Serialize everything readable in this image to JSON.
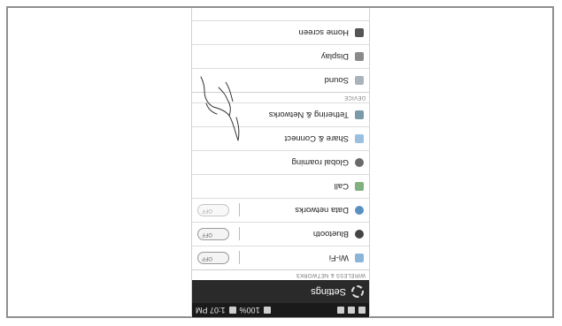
{
  "status": {
    "time": "1:07 PM",
    "battery": "100%"
  },
  "header": {
    "title": "Settings"
  },
  "sections": {
    "wireless": "WIRELESS & NETWORKS",
    "device": "DEVICE"
  },
  "rows": {
    "wifi": "Wi-Fi",
    "bluetooth": "Bluetooth",
    "data": "Data networks",
    "call": "Call",
    "global": "Global roaming",
    "share": "Share & Connect",
    "tether": "Tethering & Networks",
    "sound": "Sound",
    "display": "Display",
    "home": "Home screen"
  },
  "toggle_label": "OFF",
  "colors": {
    "actionbar": "#2a2a2a",
    "statusbar": "#1a1a1a"
  }
}
